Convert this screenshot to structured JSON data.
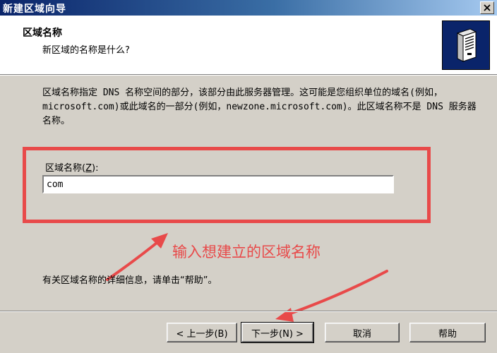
{
  "window": {
    "title": "新建区域向导",
    "close_icon": "close-icon"
  },
  "header": {
    "title": "区域名称",
    "subtitle": "新区域的名称是什么?",
    "icon": "server-icon"
  },
  "description": "区域名称指定 DNS 名称空间的部分，该部分由此服务器管理。这可能是您组织单位的域名(例如，microsoft.com)或此域名的一部分(例如，newzone.microsoft.com)。此区域名称不是 DNS 服务器名称。",
  "zone_name": {
    "label": "区域名称",
    "accesskey": "Z",
    "label_suffix": "):",
    "value": "com"
  },
  "annotation": {
    "text": "输入想建立的区域名称",
    "color": "#e84a4a"
  },
  "help_text": "有关区域名称的详细信息，请单击“帮助”。",
  "buttons": {
    "back": "< 上一步(B)",
    "next": "下一步(N) >",
    "cancel": "取消",
    "help": "帮助"
  },
  "colors": {
    "title_bar": "#0a246a",
    "dialog_bg": "#d4d0c8",
    "highlight": "#e84a4a"
  }
}
